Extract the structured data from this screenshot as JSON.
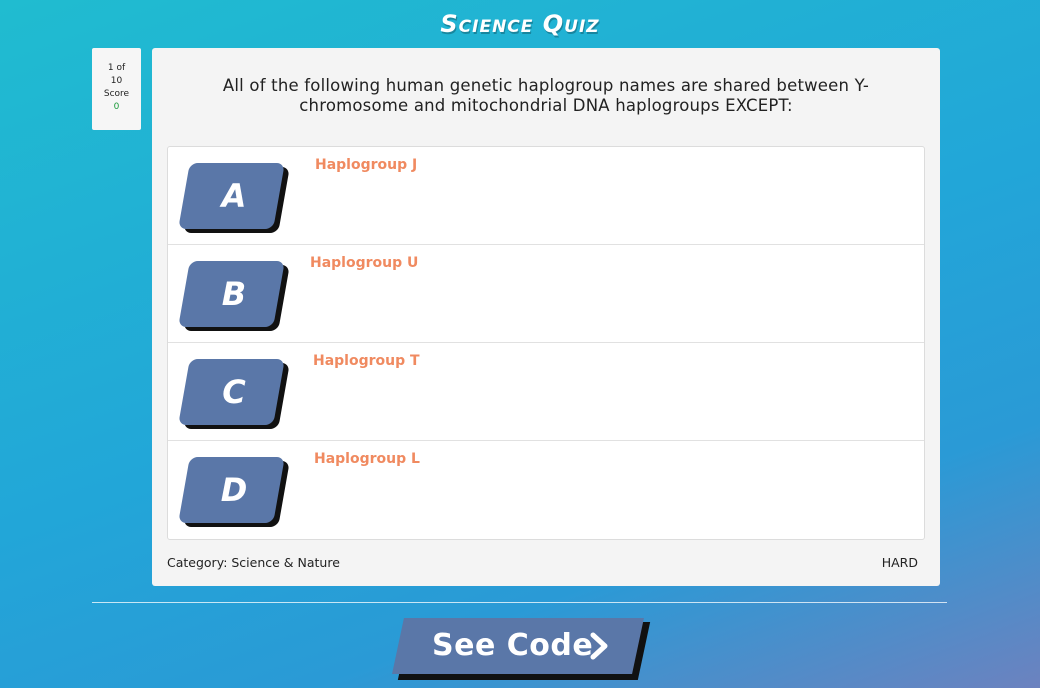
{
  "header": {
    "title": "Science Quiz"
  },
  "progress": {
    "current": "1 of",
    "total": "10",
    "score_label": "Score",
    "score_value": "0"
  },
  "question": {
    "text": "All of the following human genetic haplogroup names are shared between Y-chromosome and mitochondrial DNA haplogroups EXCEPT:"
  },
  "answers": [
    {
      "letter": "A",
      "text": "Haplogroup J"
    },
    {
      "letter": "B",
      "text": "Haplogroup U"
    },
    {
      "letter": "C",
      "text": "Haplogroup T"
    },
    {
      "letter": "D",
      "text": "Haplogroup L"
    }
  ],
  "footer": {
    "category": "Category: Science & Nature",
    "difficulty": "HARD"
  },
  "see_code": {
    "label": "See Code",
    "icon": "chevron-right-icon"
  },
  "colors": {
    "accent_button": "#5a77a8",
    "answer_text": "#f08a60",
    "score_value": "#1b9a3b"
  }
}
